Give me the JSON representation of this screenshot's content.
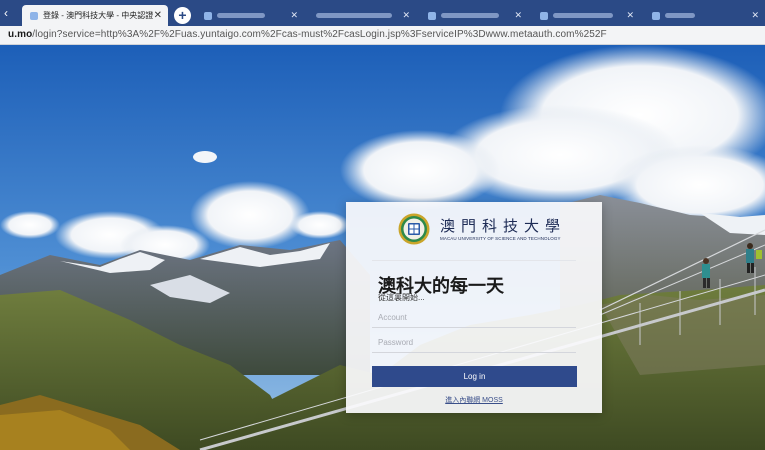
{
  "browser": {
    "active_tab_title": "登錄 - 澳門科技大學 - 中央認證",
    "url_host": "u.mo",
    "url_path": "/login?service=http%3A%2F%2Fuas.yuntaigo.com%2Fcas-must%2FcasLogin.jsp%3FserviceIP%3Dwww.metaauth.com%252F"
  },
  "login": {
    "logo_cn": "澳門科技大學",
    "logo_en": "MACAU UNIVERSITY OF SCIENCE AND TECHNOLOGY",
    "headline": "澳科大的每一天",
    "subline": "從這裏開始...",
    "account_placeholder": "Account",
    "password_placeholder": "Password",
    "login_button": "Log in",
    "moss_link": "進入內聯網 MOSS"
  },
  "colors": {
    "tabbar": "#2b4a86",
    "primary_button": "#2f4a8c",
    "link": "#3a4f8a"
  }
}
